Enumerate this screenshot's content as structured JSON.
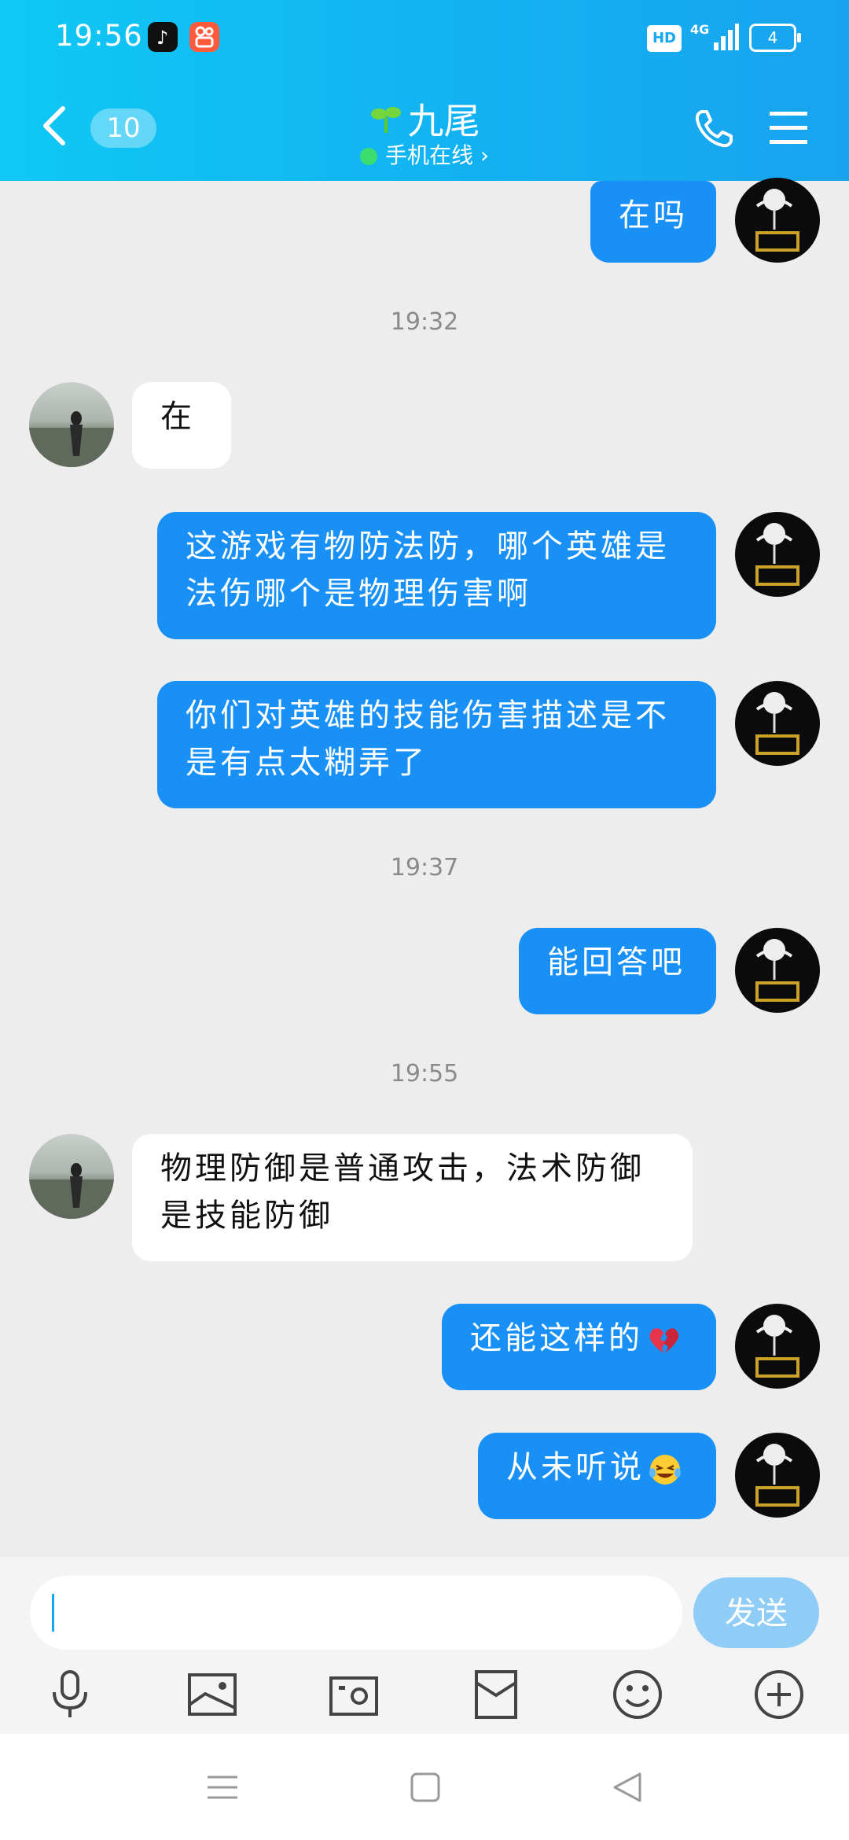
{
  "status_bar": {
    "time": "19:56",
    "network": "4G",
    "hd": "HD",
    "battery": "4"
  },
  "header": {
    "back_count": "10",
    "contact_name": "九尾",
    "online_status": "手机在线"
  },
  "messages": [
    {
      "side": "me",
      "text": "在吗"
    },
    {
      "type": "timestamp",
      "text": "19:32"
    },
    {
      "side": "other",
      "text": "在"
    },
    {
      "side": "me",
      "text": "这游戏有物防法防，哪个英雄是法伤哪个是物理伤害啊"
    },
    {
      "side": "me",
      "text": "你们对英雄的技能伤害描述是不是有点太糊弄了"
    },
    {
      "type": "timestamp",
      "text": "19:37"
    },
    {
      "side": "me",
      "text": "能回答吧"
    },
    {
      "type": "timestamp",
      "text": "19:55"
    },
    {
      "side": "other",
      "text": "物理防御是普通攻击，法术防御是技能防御"
    },
    {
      "side": "me",
      "text": "还能这样的",
      "emoji": "broken-heart-icon"
    },
    {
      "side": "me",
      "text": "从未听说",
      "emoji": "laughing-tears-icon"
    }
  ],
  "input": {
    "value": "",
    "send_label": "发送"
  },
  "toolbar": [
    "microphone-icon",
    "image-icon",
    "camera-icon",
    "red-packet-icon",
    "smiley-icon",
    "plus-icon"
  ],
  "nav_bar": [
    "menu-icon",
    "home-icon",
    "back-icon"
  ],
  "colors": {
    "header": "#12b2f2",
    "my_bubble": "#1890f5",
    "other_bubble": "#ffffff",
    "send_button": "#8fcdf6",
    "background": "#ededed"
  }
}
